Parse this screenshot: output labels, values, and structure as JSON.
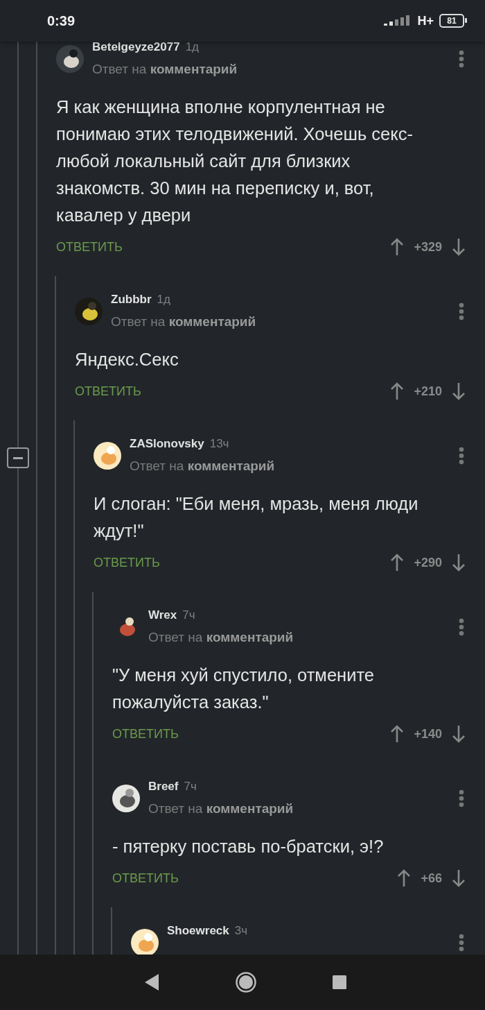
{
  "status_bar": {
    "time": "0:39",
    "network": "H+",
    "battery": "81"
  },
  "comments": [
    {
      "author": "Betelgeyze2077",
      "time": "1д",
      "avatar": {
        "kind": "dark"
      },
      "reply_line": "Ответ на **комментарий**",
      "text": "Я как женщина вполне корпулентная не понимаю этих телодвижений. Хочешь секс- любой локальный сайт для близких знакомств. 30 мин на переписку и, вот, кавалер у двери",
      "reply_button": "ОТВЕТИТЬ",
      "score": "+329",
      "children": [
        {
          "author": "Zubbbr",
          "time": "1д",
          "avatar": {
            "kind": "city"
          },
          "reply_line": "Ответ на **комментарий**",
          "text": "Яндекс.Секс",
          "reply_button": "ОТВЕТИТЬ",
          "score": "+210",
          "children": [
            {
              "author": "ZASlonovsky",
              "time": "13ч",
              "avatar": {
                "kind": "chef"
              },
              "thread_toggle": {
                "expanded": true
              },
              "reply_line": "Ответ на **комментарий**",
              "text": "И слоган: \"Еби меня, мразь, меня люди ждут!\"",
              "reply_button": "ОТВЕТИТЬ",
              "score": "+290",
              "children": [
                {
                  "author": "Wrex",
                  "time": "7ч",
                  "avatar": {
                    "kind": "spiky"
                  },
                  "reply_line": "Ответ на **комментарий**",
                  "text": "\"У меня хуй спустило, отмените пожалуйста заказ.\"",
                  "reply_button": "ОТВЕТИТЬ",
                  "score": "+140"
                },
                {
                  "author": "Breef",
                  "time": "7ч",
                  "avatar": {
                    "kind": "emblem"
                  },
                  "reply_line": "Ответ на **комментарий**",
                  "text": "- пятерку поставь по-братски, э!?",
                  "reply_button": "ОТВЕТИТЬ",
                  "score": "+66",
                  "children": [
                    {
                      "author": "Shoewreck",
                      "time": "3ч",
                      "avatar": {
                        "kind": "chef"
                      }
                    }
                  ]
                }
              ]
            }
          ]
        }
      ]
    }
  ]
}
